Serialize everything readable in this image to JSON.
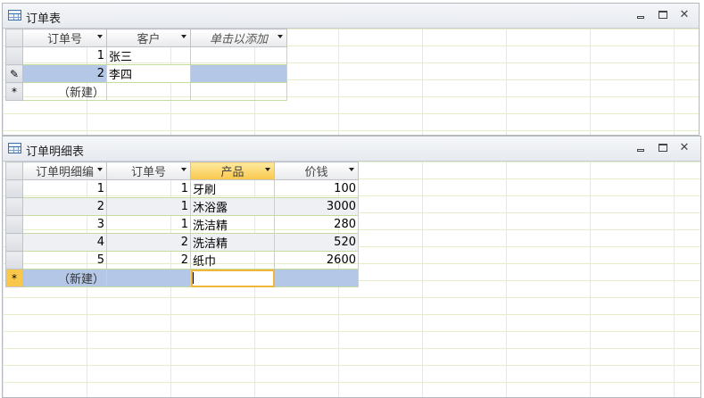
{
  "orders_window": {
    "title": "订单表",
    "columns": [
      "订单号",
      "客户",
      "单击以添加"
    ],
    "rows": [
      {
        "id": "1",
        "customer": "张三"
      },
      {
        "id": "2",
        "customer": "李四"
      }
    ],
    "new_row_label": "（新建）",
    "edit_marker": "✎",
    "new_marker": "*"
  },
  "details_window": {
    "title": "订单明细表",
    "columns": [
      "订单明细编",
      "订单号",
      "产品",
      "价钱"
    ],
    "rows": [
      {
        "detail_id": "1",
        "order_id": "1",
        "product": "牙刷",
        "price": "100"
      },
      {
        "detail_id": "2",
        "order_id": "1",
        "product": "沐浴露",
        "price": "3000"
      },
      {
        "detail_id": "3",
        "order_id": "1",
        "product": "洗洁精",
        "price": "280"
      },
      {
        "detail_id": "4",
        "order_id": "2",
        "product": "洗洁精",
        "price": "520"
      },
      {
        "detail_id": "5",
        "order_id": "2",
        "product": "纸巾",
        "price": "2600"
      }
    ],
    "new_row_label": "（新建）",
    "new_marker": "*"
  },
  "window_buttons": {
    "minimize": "",
    "maximize": "",
    "close": "✕"
  },
  "colors": {
    "selection": "#b5c7e6",
    "active_header": "#f9c84a",
    "gridline": "#c6dba0"
  }
}
